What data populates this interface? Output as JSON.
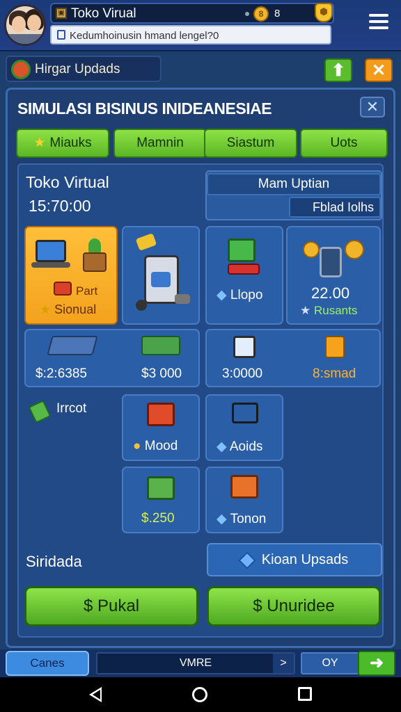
{
  "header": {
    "app_title": "Toko Virual",
    "coin_value": "8",
    "search_value": "Kedumhoinusin hmand lengel?0"
  },
  "banner": {
    "text": "Hirgar Updads"
  },
  "panel": {
    "title": "SIMULASI BISINUS INIDEANESIAE",
    "tabs": [
      "Miauks",
      "Mamnin",
      "Siastum",
      "Uots"
    ]
  },
  "store": {
    "name": "Toko Virtual",
    "time": "15:70:00",
    "main_update": "Mam Uptian",
    "stats_label": "Fblad Iolhs"
  },
  "cards": {
    "part_label": "Part",
    "signal_label": "Sionual",
    "shop_label": "Llopo",
    "coins_value": "22.00",
    "rusants_label": "Rusants",
    "price1": "$:2:6385",
    "price2": "$3 000",
    "price3": "3:0000",
    "price4": "8:smad",
    "tract_label": "Irrcot",
    "mood_label": "Mood",
    "aoids_label": "Aoids",
    "price5": "$.250",
    "ionon_label": "Tonon"
  },
  "bottom": {
    "label": "Siridada",
    "upgrade_label": "Kioan Upsads",
    "buy_label": "$ Pukal",
    "unlock_label": "$ Unuridee"
  },
  "footer": {
    "cancel_label": "Canes",
    "mid_label": "VMRE",
    "ok_label": "OY"
  }
}
